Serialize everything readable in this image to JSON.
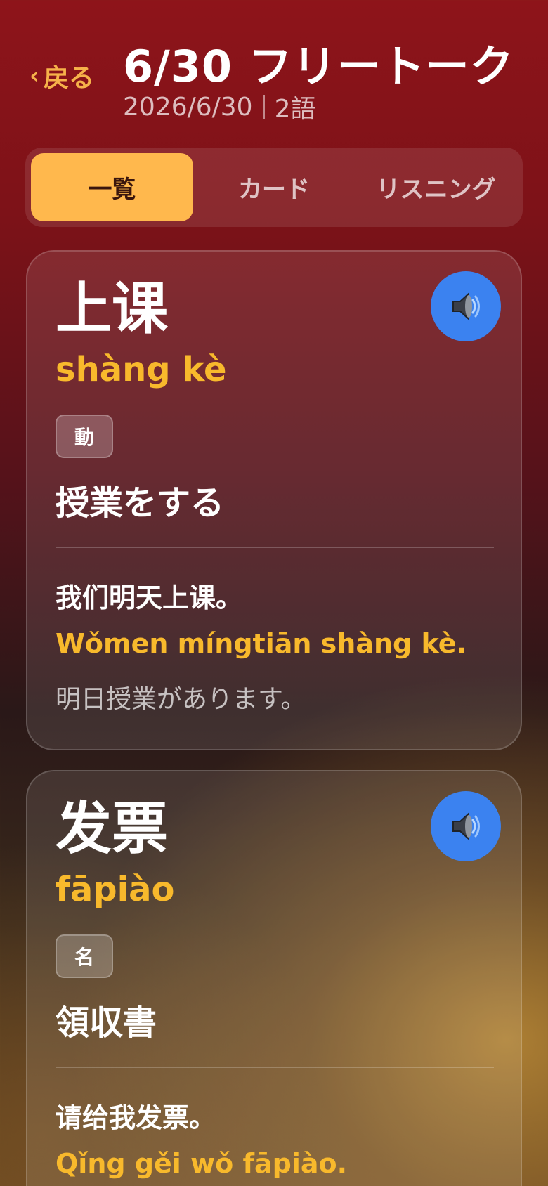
{
  "header": {
    "back_label": "戻る",
    "back_chevron": "‹",
    "title": "6/30 フリートーク",
    "date": "2026/6/30",
    "word_count": "2語"
  },
  "tabs": [
    {
      "label": "一覧",
      "active": true
    },
    {
      "label": "カード",
      "active": false
    },
    {
      "label": "リスニング",
      "active": false
    }
  ],
  "cards": [
    {
      "word": "上课",
      "pinyin": "shàng kè",
      "pos": "動",
      "meaning": "授業をする",
      "example_zh": "我们明天上课。",
      "example_pinyin": "Wǒmen míngtiān shàng kè.",
      "example_ja": "明日授業があります。",
      "speak_icon": "speaker-icon"
    },
    {
      "word": "发票",
      "pinyin": "fāpiào",
      "pos": "名",
      "meaning": "領収書",
      "example_zh": "请给我发票。",
      "example_pinyin": "Qǐng gěi wǒ fāpiào.",
      "example_ja": "",
      "speak_icon": "speaker-icon"
    }
  ],
  "colors": {
    "accent": "#ffb84d",
    "pinyin": "#f8b92c",
    "speak_button": "#3b82f0"
  }
}
